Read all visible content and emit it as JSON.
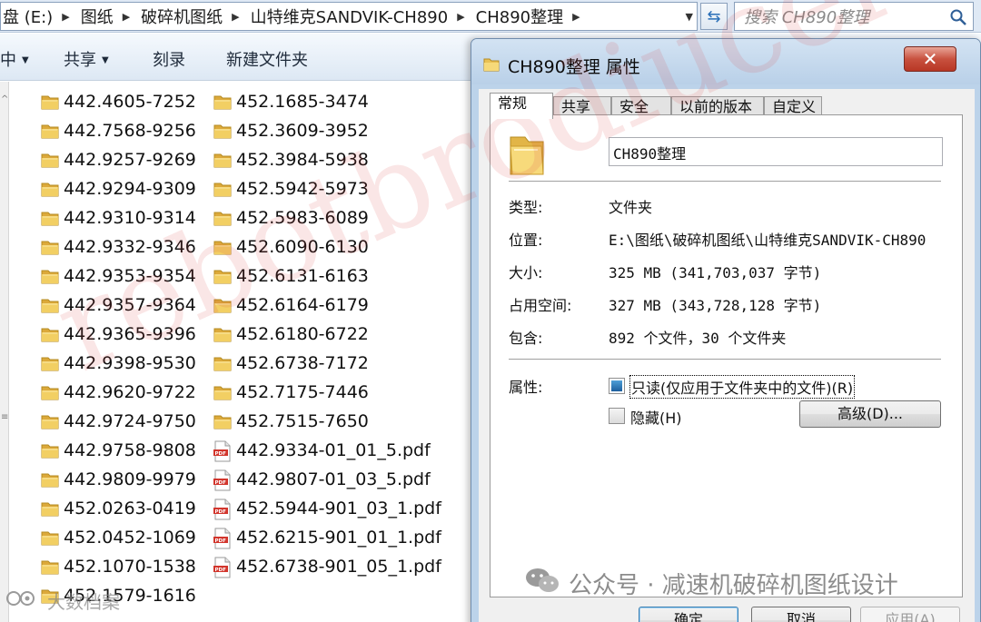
{
  "explorer": {
    "breadcrumb": [
      "盘 (E:)",
      "图纸",
      "破碎机图纸",
      "山特维克SANDVIK-CH890",
      "CH890整理"
    ],
    "search_placeholder": "搜索 CH890整理",
    "toolbar": {
      "organize_label": "中",
      "share_label": "共享",
      "burn_label": "刻录",
      "new_folder_label": "新建文件夹"
    },
    "files_col1": [
      {
        "name": "442.4605-7252",
        "type": "folder"
      },
      {
        "name": "442.7568-9256",
        "type": "folder"
      },
      {
        "name": "442.9257-9269",
        "type": "folder"
      },
      {
        "name": "442.9294-9309",
        "type": "folder"
      },
      {
        "name": "442.9310-9314",
        "type": "folder"
      },
      {
        "name": "442.9332-9346",
        "type": "folder"
      },
      {
        "name": "442.9353-9354",
        "type": "folder"
      },
      {
        "name": "442.9357-9364",
        "type": "folder"
      },
      {
        "name": "442.9365-9396",
        "type": "folder"
      },
      {
        "name": "442.9398-9530",
        "type": "folder"
      },
      {
        "name": "442.9620-9722",
        "type": "folder"
      },
      {
        "name": "442.9724-9750",
        "type": "folder"
      },
      {
        "name": "442.9758-9808",
        "type": "folder"
      },
      {
        "name": "442.9809-9979",
        "type": "folder"
      },
      {
        "name": "452.0263-0419",
        "type": "folder"
      },
      {
        "name": "452.0452-1069",
        "type": "folder"
      },
      {
        "name": "452.1070-1538",
        "type": "folder"
      },
      {
        "name": "452.1579-1616",
        "type": "folder"
      }
    ],
    "files_col2": [
      {
        "name": "452.1685-3474",
        "type": "folder"
      },
      {
        "name": "452.3609-3952",
        "type": "folder"
      },
      {
        "name": "452.3984-5938",
        "type": "folder"
      },
      {
        "name": "452.5942-5973",
        "type": "folder"
      },
      {
        "name": "452.5983-6089",
        "type": "folder"
      },
      {
        "name": "452.6090-6130",
        "type": "folder"
      },
      {
        "name": "452.6131-6163",
        "type": "folder"
      },
      {
        "name": "452.6164-6179",
        "type": "folder"
      },
      {
        "name": "452.6180-6722",
        "type": "folder"
      },
      {
        "name": "452.6738-7172",
        "type": "folder"
      },
      {
        "name": "452.7175-7446",
        "type": "folder"
      },
      {
        "name": "452.7515-7650",
        "type": "folder"
      },
      {
        "name": "442.9334-01_01_5.pdf",
        "type": "pdf"
      },
      {
        "name": "442.9807-01_03_5.pdf",
        "type": "pdf"
      },
      {
        "name": "452.5944-901_03_1.pdf",
        "type": "pdf"
      },
      {
        "name": "452.6215-901_01_1.pdf",
        "type": "pdf"
      },
      {
        "name": "452.6738-901_05_1.pdf",
        "type": "pdf"
      }
    ]
  },
  "dialog": {
    "title": "CH890整理 属性",
    "close_label": "✕",
    "tabs": [
      "常规",
      "共享",
      "安全",
      "以前的版本",
      "自定义"
    ],
    "active_tab": "常规",
    "folder_name": "CH890整理",
    "properties": {
      "type_label": "类型:",
      "type_value": "文件夹",
      "location_label": "位置:",
      "location_value": "E:\\图纸\\破碎机图纸\\山特维克SANDVIK-CH890",
      "size_label": "大小:",
      "size_value": "325 MB (341,703,037 字节)",
      "size_on_disk_label": "占用空间:",
      "size_on_disk_value": "327 MB (343,728,128 字节)",
      "contains_label": "包含:",
      "contains_value": "892 个文件，30 个文件夹"
    },
    "attributes": {
      "label": "属性:",
      "readonly_label": "只读(仅应用于文件夹中的文件)(R)",
      "hidden_label": "隐藏(H)",
      "advanced_button": "高级(D)..."
    },
    "buttons": {
      "ok": "确定",
      "cancel": "取消",
      "apply": "应用(A)"
    }
  },
  "watermarks": {
    "diagonal": "rebotbrodiucel",
    "wechat": "公众号 · 减速机破碎机图纸设计",
    "corner": "大数档案"
  },
  "colors": {
    "folder": "#f2cf63",
    "pdf_red": "#d2352c",
    "close_red": "#c8513f",
    "accent_blue": "#2a6fb8"
  }
}
